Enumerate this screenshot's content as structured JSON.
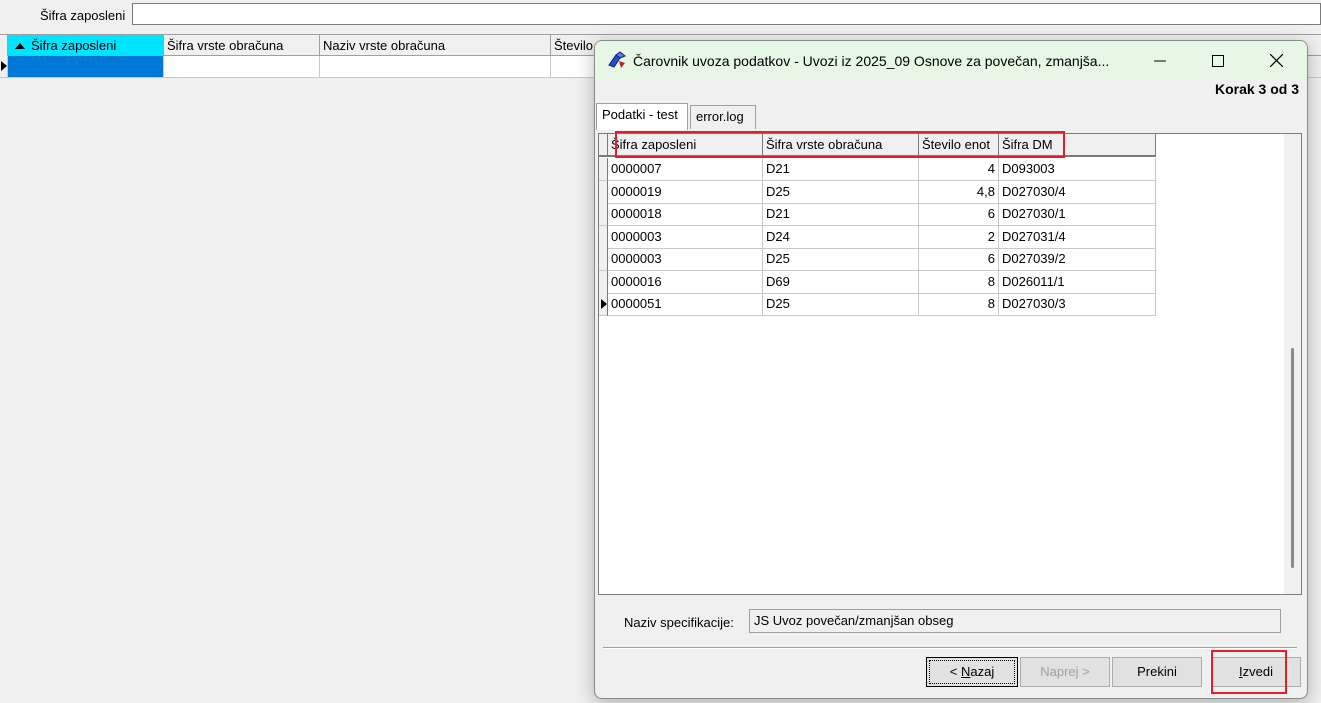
{
  "background": {
    "filter_label": "Šifra zaposleni",
    "columns": [
      "Šifra zaposleni",
      "Šifra vrste obračuna",
      "Naziv vrste obračuna",
      "Število"
    ]
  },
  "dialog": {
    "title": "Čarovnik uvoza podatkov - Uvozi iz 2025_09 Osnove za povečan, zmanjša...",
    "step": "Korak 3 od 3",
    "tabs": [
      "Podatki - test",
      "error.log"
    ],
    "grid": {
      "columns": [
        "Šifra zaposleni",
        "Šifra vrste obračuna",
        "Število enot",
        "Šifra DM"
      ],
      "rows": [
        [
          "0000007",
          "D21",
          "4",
          "D093003"
        ],
        [
          "0000019",
          "D25",
          "4,8",
          "D027030/4"
        ],
        [
          "0000018",
          "D21",
          "6",
          "D027030/1"
        ],
        [
          "0000003",
          "D24",
          "2",
          "D027031/4"
        ],
        [
          "0000003",
          "D25",
          "6",
          "D027039/2"
        ],
        [
          "0000016",
          "D69",
          "8",
          "D026011/1"
        ],
        [
          "0000051",
          "D25",
          "8",
          "D027030/3"
        ]
      ],
      "current_row": 6
    },
    "spec_label": "Naziv specifikacije:",
    "spec_value": "JS Uvoz povečan/zmanjšan obseg",
    "buttons": {
      "back_prefix": "< ",
      "back_key": "N",
      "back_rest": "azaj",
      "next": "Naprej >",
      "cancel": "Prekini",
      "run_key": "I",
      "run_rest": "zvedi"
    }
  },
  "icons": [
    "wizard-app-icon",
    "minimize-icon",
    "maximize-icon",
    "close-icon",
    "row-pointer-icon",
    "sort-ascending-icon"
  ],
  "colors": {
    "highlight": "#e0202a",
    "active_header": "#00e5ff",
    "selection": "#0078d7",
    "titlebar": "#e6f7e6"
  }
}
